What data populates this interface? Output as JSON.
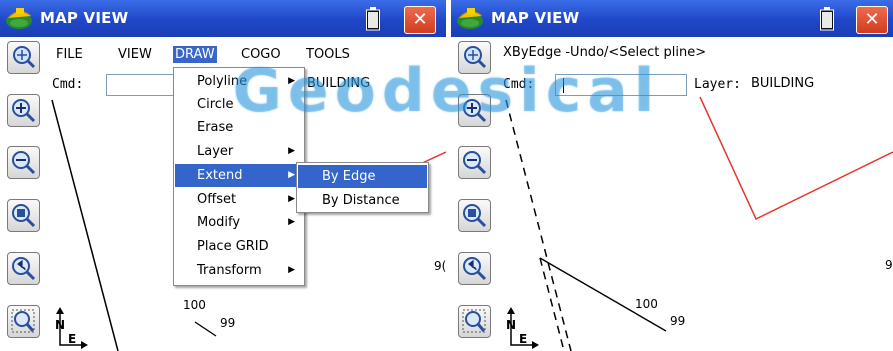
{
  "watermark": "Geodesical",
  "left_pane": {
    "title": "MAP VIEW",
    "close_label": "✕",
    "menu": [
      "FILE",
      "VIEW",
      "DRAW",
      "COGO",
      "TOOLS"
    ],
    "active_menu": "DRAW",
    "cmd_label": "Cmd:",
    "layer_value": "BUILDING",
    "draw_menu": [
      {
        "label": "Polyline",
        "submenu": true
      },
      {
        "label": "Circle",
        "submenu": false
      },
      {
        "label": "Erase",
        "submenu": false
      },
      {
        "label": "Layer",
        "submenu": true
      },
      {
        "label": "Extend",
        "submenu": true,
        "highlighted": true
      },
      {
        "label": "Offset",
        "submenu": true
      },
      {
        "label": "Modify",
        "submenu": true
      },
      {
        "label": "Place GRID",
        "submenu": false
      },
      {
        "label": "Transform",
        "submenu": true
      }
    ],
    "extend_submenu": [
      {
        "label": "By Edge",
        "highlighted": true
      },
      {
        "label": "By Distance",
        "highlighted": false
      }
    ],
    "map_labels": {
      "point_100": "100",
      "point_99": "99",
      "clipped": "9("
    }
  },
  "right_pane": {
    "title": "MAP VIEW",
    "close_label": "✕",
    "prompt": "XByEdge -Undo/<Select pline>",
    "cmd_label": "Cmd:",
    "cmd_value": "",
    "layer_label": "Layer:",
    "layer_value": "BUILDING",
    "map_labels": {
      "point_100": "100",
      "point_99": "99",
      "clipped": "9"
    }
  },
  "toolbar_icons": [
    "pan-zoom-icon",
    "zoom-in-icon",
    "zoom-out-icon",
    "zoom-extents-icon",
    "zoom-previous-icon",
    "zoom-window-icon"
  ],
  "north_label": "N",
  "east_label": "E",
  "colors": {
    "titlebar": "#2149c6",
    "close_button": "#dd4a2b",
    "menu_highlight": "#3465cb",
    "building_line": "#e8342c",
    "watermark": "#2896dc"
  }
}
